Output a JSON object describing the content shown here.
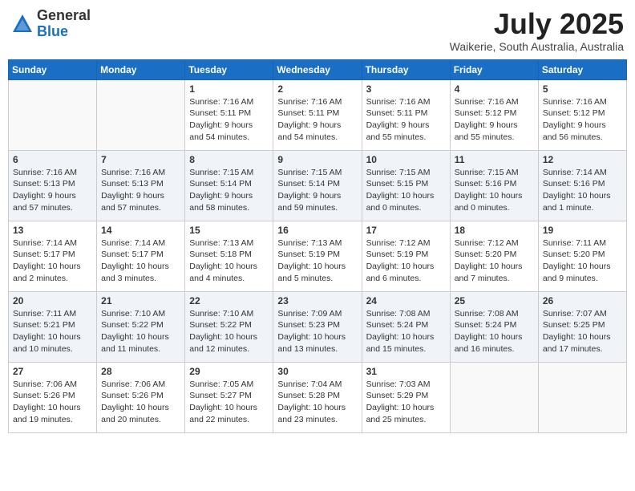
{
  "header": {
    "logo_general": "General",
    "logo_blue": "Blue",
    "month_year": "July 2025",
    "location": "Waikerie, South Australia, Australia"
  },
  "weekdays": [
    "Sunday",
    "Monday",
    "Tuesday",
    "Wednesday",
    "Thursday",
    "Friday",
    "Saturday"
  ],
  "weeks": [
    [
      {
        "day": "",
        "info": ""
      },
      {
        "day": "",
        "info": ""
      },
      {
        "day": "1",
        "info": "Sunrise: 7:16 AM\nSunset: 5:11 PM\nDaylight: 9 hours\nand 54 minutes."
      },
      {
        "day": "2",
        "info": "Sunrise: 7:16 AM\nSunset: 5:11 PM\nDaylight: 9 hours\nand 54 minutes."
      },
      {
        "day": "3",
        "info": "Sunrise: 7:16 AM\nSunset: 5:11 PM\nDaylight: 9 hours\nand 55 minutes."
      },
      {
        "day": "4",
        "info": "Sunrise: 7:16 AM\nSunset: 5:12 PM\nDaylight: 9 hours\nand 55 minutes."
      },
      {
        "day": "5",
        "info": "Sunrise: 7:16 AM\nSunset: 5:12 PM\nDaylight: 9 hours\nand 56 minutes."
      }
    ],
    [
      {
        "day": "6",
        "info": "Sunrise: 7:16 AM\nSunset: 5:13 PM\nDaylight: 9 hours\nand 57 minutes."
      },
      {
        "day": "7",
        "info": "Sunrise: 7:16 AM\nSunset: 5:13 PM\nDaylight: 9 hours\nand 57 minutes."
      },
      {
        "day": "8",
        "info": "Sunrise: 7:15 AM\nSunset: 5:14 PM\nDaylight: 9 hours\nand 58 minutes."
      },
      {
        "day": "9",
        "info": "Sunrise: 7:15 AM\nSunset: 5:14 PM\nDaylight: 9 hours\nand 59 minutes."
      },
      {
        "day": "10",
        "info": "Sunrise: 7:15 AM\nSunset: 5:15 PM\nDaylight: 10 hours\nand 0 minutes."
      },
      {
        "day": "11",
        "info": "Sunrise: 7:15 AM\nSunset: 5:16 PM\nDaylight: 10 hours\nand 0 minutes."
      },
      {
        "day": "12",
        "info": "Sunrise: 7:14 AM\nSunset: 5:16 PM\nDaylight: 10 hours\nand 1 minute."
      }
    ],
    [
      {
        "day": "13",
        "info": "Sunrise: 7:14 AM\nSunset: 5:17 PM\nDaylight: 10 hours\nand 2 minutes."
      },
      {
        "day": "14",
        "info": "Sunrise: 7:14 AM\nSunset: 5:17 PM\nDaylight: 10 hours\nand 3 minutes."
      },
      {
        "day": "15",
        "info": "Sunrise: 7:13 AM\nSunset: 5:18 PM\nDaylight: 10 hours\nand 4 minutes."
      },
      {
        "day": "16",
        "info": "Sunrise: 7:13 AM\nSunset: 5:19 PM\nDaylight: 10 hours\nand 5 minutes."
      },
      {
        "day": "17",
        "info": "Sunrise: 7:12 AM\nSunset: 5:19 PM\nDaylight: 10 hours\nand 6 minutes."
      },
      {
        "day": "18",
        "info": "Sunrise: 7:12 AM\nSunset: 5:20 PM\nDaylight: 10 hours\nand 7 minutes."
      },
      {
        "day": "19",
        "info": "Sunrise: 7:11 AM\nSunset: 5:20 PM\nDaylight: 10 hours\nand 9 minutes."
      }
    ],
    [
      {
        "day": "20",
        "info": "Sunrise: 7:11 AM\nSunset: 5:21 PM\nDaylight: 10 hours\nand 10 minutes."
      },
      {
        "day": "21",
        "info": "Sunrise: 7:10 AM\nSunset: 5:22 PM\nDaylight: 10 hours\nand 11 minutes."
      },
      {
        "day": "22",
        "info": "Sunrise: 7:10 AM\nSunset: 5:22 PM\nDaylight: 10 hours\nand 12 minutes."
      },
      {
        "day": "23",
        "info": "Sunrise: 7:09 AM\nSunset: 5:23 PM\nDaylight: 10 hours\nand 13 minutes."
      },
      {
        "day": "24",
        "info": "Sunrise: 7:08 AM\nSunset: 5:24 PM\nDaylight: 10 hours\nand 15 minutes."
      },
      {
        "day": "25",
        "info": "Sunrise: 7:08 AM\nSunset: 5:24 PM\nDaylight: 10 hours\nand 16 minutes."
      },
      {
        "day": "26",
        "info": "Sunrise: 7:07 AM\nSunset: 5:25 PM\nDaylight: 10 hours\nand 17 minutes."
      }
    ],
    [
      {
        "day": "27",
        "info": "Sunrise: 7:06 AM\nSunset: 5:26 PM\nDaylight: 10 hours\nand 19 minutes."
      },
      {
        "day": "28",
        "info": "Sunrise: 7:06 AM\nSunset: 5:26 PM\nDaylight: 10 hours\nand 20 minutes."
      },
      {
        "day": "29",
        "info": "Sunrise: 7:05 AM\nSunset: 5:27 PM\nDaylight: 10 hours\nand 22 minutes."
      },
      {
        "day": "30",
        "info": "Sunrise: 7:04 AM\nSunset: 5:28 PM\nDaylight: 10 hours\nand 23 minutes."
      },
      {
        "day": "31",
        "info": "Sunrise: 7:03 AM\nSunset: 5:29 PM\nDaylight: 10 hours\nand 25 minutes."
      },
      {
        "day": "",
        "info": ""
      },
      {
        "day": "",
        "info": ""
      }
    ]
  ]
}
